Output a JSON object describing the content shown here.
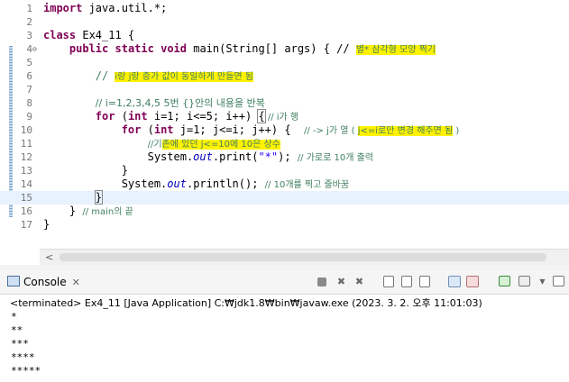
{
  "editor": {
    "lines": [
      {
        "n": "1"
      },
      {
        "n": "2"
      },
      {
        "n": "3"
      },
      {
        "n": "4"
      },
      {
        "n": "5"
      },
      {
        "n": "6"
      },
      {
        "n": "7"
      },
      {
        "n": "8"
      },
      {
        "n": "9"
      },
      {
        "n": "10"
      },
      {
        "n": "11"
      },
      {
        "n": "12"
      },
      {
        "n": "13"
      },
      {
        "n": "14"
      },
      {
        "n": "15"
      },
      {
        "n": "16"
      },
      {
        "n": "17"
      }
    ],
    "l1_kw": "import",
    "l1_rest": " java.util.*;",
    "l3_kw": "class",
    "l3_rest": " Ex4_11 {",
    "l4_kw1": "public",
    "l4_kw2": "static",
    "l4_kw3": "void",
    "l4_rest": " main(String[] args) { // ",
    "l4_comment": "별* 삼각형 모양 찍기",
    "l6_prefix": "// ",
    "l6_comment": "i랑 j랑 증가 값이 동일하게 만들면 됨",
    "l8_comment": "// i=1,2,3,4,5 5번 {}안의 내용을 반복",
    "l9_kw1": "for",
    "l9_mid": " (",
    "l9_kw2": "int",
    "l9_rest": " i=1; i<=5; i++) ",
    "l9_brace": "{",
    "l9_comment": " // i가 행",
    "l10_kw1": "for",
    "l10_mid": " (",
    "l10_kw2": "int",
    "l10_rest": " j=1; j<=i; j++) {  ",
    "l10_comment": "// -> j가 열 ( ",
    "l10_hl": "j<=i로만 변경 해주면 됨",
    "l10_tail": " )",
    "l11_prefix": "//기",
    "l11_hl": "존에 있던 j<=10에 10은 상수",
    "l12_obj": "System.",
    "l12_out": "out",
    "l12_mid": ".print(",
    "l12_str": "\"*\"",
    "l12_end": "); ",
    "l12_comment": "// 가로로 10개 출력",
    "l13_text": "}",
    "l14_obj": "System.",
    "l14_out": "out",
    "l14_mid": ".println(); ",
    "l14_comment": "// 10개를 찍고 줄바꿈",
    "l15_text": "}",
    "l16_text": "} ",
    "l16_comment": "// main의 끝",
    "l17_text": "}"
  },
  "scrollbar": {
    "left_arrow": "<"
  },
  "console": {
    "tab_label": "Console",
    "tab_close": "✕",
    "status": "<terminated> Ex4_11 [Java Application] C:₩jdk1.8₩bin₩javaw.exe (2023. 3. 2. 오후 11:01:03)",
    "output": [
      "*",
      "**",
      "***",
      "****",
      "*****"
    ]
  },
  "colors": {
    "keyword": "#7f0055",
    "comment": "#3f7f5f",
    "string": "#2a00ff",
    "highlight": "#fff200"
  }
}
